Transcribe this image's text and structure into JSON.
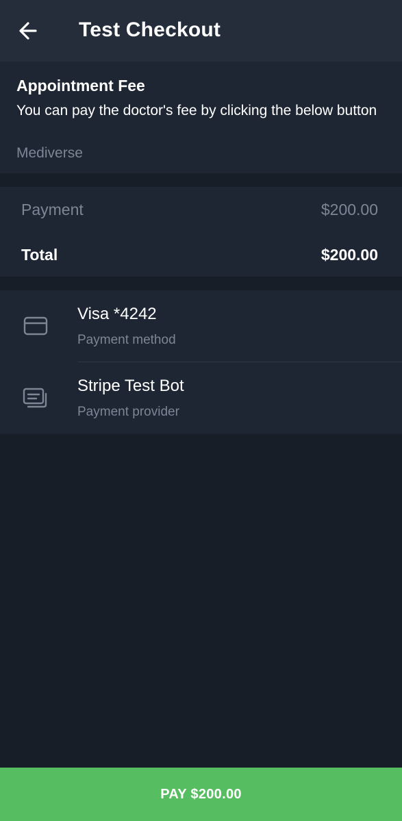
{
  "header": {
    "back_icon": "arrow-left-icon",
    "title": "Test Checkout"
  },
  "invoice": {
    "title": "Appointment Fee",
    "description": "You can pay the doctor's fee by clicking the below button",
    "brand": "Mediverse"
  },
  "prices": {
    "payment_label": "Payment",
    "payment_value": "$200.00",
    "total_label": "Total",
    "total_value": "$200.00"
  },
  "methods": [
    {
      "icon": "credit-card-icon",
      "title": "Visa *4242",
      "subtitle": "Payment method"
    },
    {
      "icon": "payment-provider-icon",
      "title": "Stripe Test Bot",
      "subtitle": "Payment provider"
    }
  ],
  "pay_button": {
    "label": "PAY $200.00"
  },
  "colors": {
    "background": "#171e28",
    "header": "#252d3b",
    "card": "#1e2633",
    "muted_text": "#7c8694",
    "pay_button": "#56be60"
  }
}
